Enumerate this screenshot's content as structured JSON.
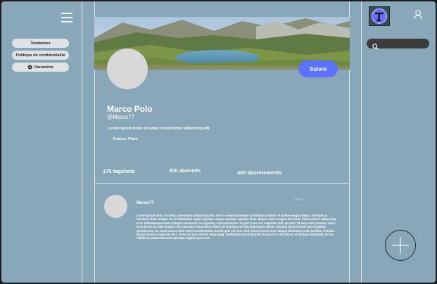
{
  "sidebar": {
    "items": [
      {
        "label": "Tendances",
        "icon": ""
      },
      {
        "label": "Politique de confidentialité",
        "icon": ""
      },
      {
        "label": "Paramètre",
        "icon": "gear-icon"
      }
    ]
  },
  "profile": {
    "name": "Marco Polo",
    "handle": "@Marco77",
    "bio": "Lorem ipsum dolor sit amet, consectetur adipiscing elit",
    "location": "France, Paris",
    "follow_label": "Suivre",
    "stats": {
      "tagshots": "175 tagshots",
      "followers": "300 abonnés",
      "following": "400 abonnements"
    }
  },
  "post": {
    "author": "Marco77",
    "time": "15min",
    "text": "Lorem ipsum dolor sit amet, consectetur adipiscing elit, sed do eiusmod tempor incididunt ut labore et dolore magna aliqua. Volutpat ac tincidunt vitae semper. Eu mi bibendum neque egestas congue quisque egestas diam. Mauris nunc congue nisi vitae. Risus viverra adipiscing at in. Pellentesque diam volutpat commodo sed egestas. Euismod lacinia at quis risus sed vulputate odio ut enim. Ut sem nulla pharetra diam. Eros donec ac odio tempor orci. Interdum consectetur libero id faucibus nisl tincidunt eget nullam. Volutpat lacus laoreet non curabitur gravida arcu ac. Amet massa vitae tortor condimentum lacinia quis vel eros. Sed viverra ipsum nunc aliquet bibendum enim facilisis. Gravida dictum fusce ut placerat orci. Tortor at risus viverra adipiscing. Vestibulum morbi blandit cursus risus at ultrices mi tempus imperdiet. In hac habitasse platea dictumst quisque sagittis purus sit."
  },
  "search": {
    "placeholder": "",
    "value": ""
  },
  "colors": {
    "background": "#88a7b8",
    "accent": "#5b72ff",
    "divider": "#dfe9ef"
  }
}
